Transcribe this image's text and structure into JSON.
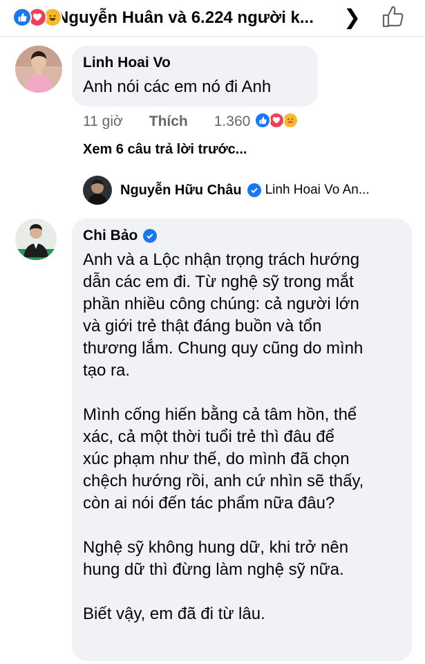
{
  "header": {
    "reactors_text": "Nguyễn Huân và 6.224 người k...",
    "chevron_icon": "chevron-right-icon",
    "like_icon": "thumbs-up-outline-icon"
  },
  "comment1": {
    "author": "Linh Hoai Vo",
    "text": "Anh nói các em nó đi Anh",
    "time": "11 giờ",
    "like_label": "Thích",
    "reaction_count": "1.360"
  },
  "view_more": "Xem 6 câu trả lời trước...",
  "reply_preview": {
    "author": "Nguyễn Hữu Châu",
    "text": "Linh Hoai Vo  An..."
  },
  "comment2": {
    "author": "Chi Bảo",
    "paragraphs": [
      [
        "Anh và a Lộc nhận trọng trách hướng",
        "dẫn các em đi. Từ nghệ sỹ trong mắt",
        "phần nhiều công chúng: cả người lớn",
        "và giới trẻ thật đáng buồn và tổn",
        "thương lắm. Chung quy cũng do mình",
        "tạo ra."
      ],
      [
        "Mình cống hiến bằng cả tâm hồn, thể",
        "xác, cả một thời tuổi trẻ thì đâu để",
        "xúc phạm như thế, do mình đã chọn",
        "chệch hướng rồi, anh cứ nhìn sẽ thấy,",
        "còn ai nói đến tác phẩm nữa đâu?"
      ],
      [
        "Nghệ sỹ không hung dữ, khi trở nên",
        "hung dữ thì đừng làm nghệ sỹ nữa."
      ],
      [
        "Biết vậy, em đã đi từ lâu."
      ]
    ]
  },
  "colors": {
    "like_blue": "#1877f2",
    "love_red": "#f33e58",
    "haha_yellow": "#f7b928",
    "bubble_bg": "#f0f2f5",
    "meta_gray": "#65676b"
  }
}
